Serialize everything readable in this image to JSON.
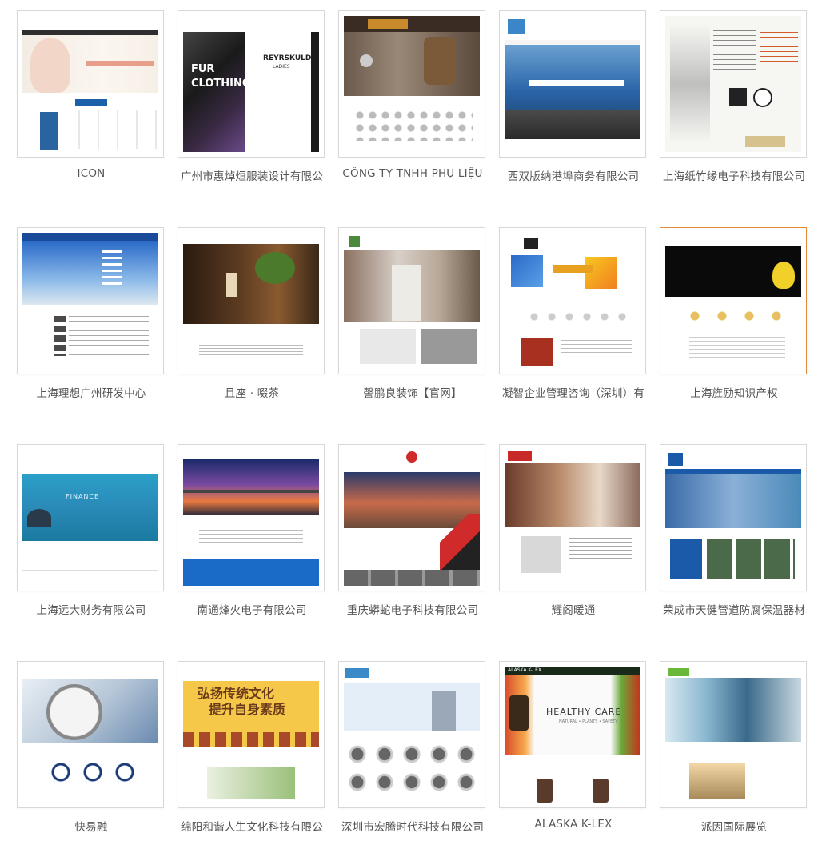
{
  "sites": [
    {
      "caption": "ICON"
    },
    {
      "caption": "广州市惠焯烜服装设计有限公",
      "overlay_lines": [
        "FUR",
        "CLOTHING"
      ],
      "brand": "REYRSKULD",
      "brand_sub": "LADIES"
    },
    {
      "caption": "CÔNG TY TNHH PHỤ LIỆU"
    },
    {
      "caption": "西双版纳港埠商务有限公司"
    },
    {
      "caption": "上海纸竹缘电子科技有限公司"
    },
    {
      "caption": "上海理想广州研发中心"
    },
    {
      "caption": "且座 · 啜茶"
    },
    {
      "caption": "謦鹏良装饰【官网】"
    },
    {
      "caption": "凝智企业管理咨询（深圳）有"
    },
    {
      "caption": "上海旌励知识产权"
    },
    {
      "caption": "上海远大财务有限公司",
      "overlay_lines": [
        "FINANCE"
      ]
    },
    {
      "caption": "南通烽火电子有限公司"
    },
    {
      "caption": "重庆蟒蛇电子科技有限公司"
    },
    {
      "caption": "耀阁暖通"
    },
    {
      "caption": "荣成市天健管道防腐保温器材"
    },
    {
      "caption": "快易融"
    },
    {
      "caption": "绵阳和谐人生文化科技有限公",
      "overlay_lines": [
        "弘扬传统文化",
        "提升自身素质"
      ]
    },
    {
      "caption": "深圳市宏腾时代科技有限公司"
    },
    {
      "caption": "ALASKA K-LEX",
      "overlay_lines": [
        "HEALTHY CARE",
        "NATURAL • PLANTS • SAFETY"
      ],
      "brand": "ALASKA K-LEX"
    },
    {
      "caption": "派因国际展览"
    }
  ]
}
